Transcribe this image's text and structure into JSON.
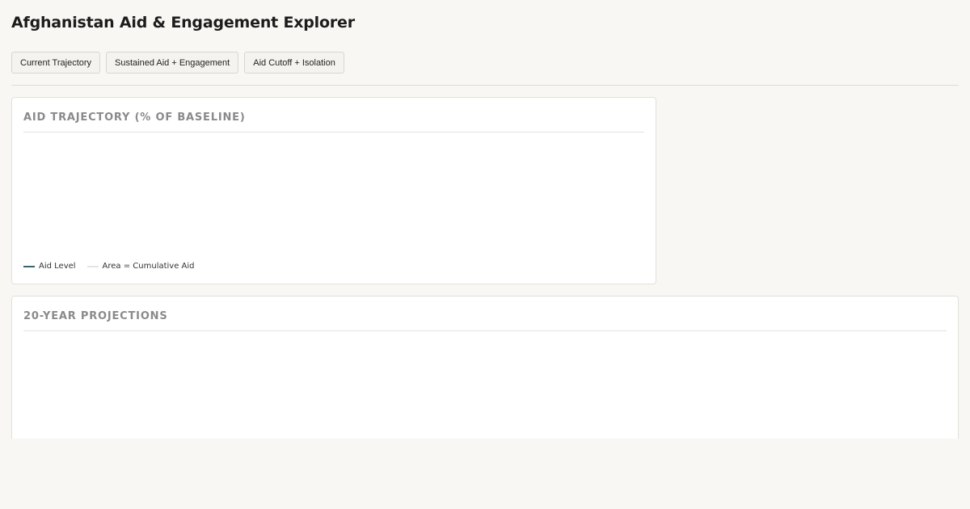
{
  "app": {
    "title": "Afghanistan Aid & Engagement Explorer"
  },
  "scenarios": [
    {
      "label": "Current Trajectory"
    },
    {
      "label": "Sustained Aid + Engagement"
    },
    {
      "label": "Aid Cutoff + Isolation"
    }
  ],
  "aid_panel": {
    "title": "AID TRAJECTORY (% OF BASELINE)",
    "legend": [
      {
        "label": "Aid Level",
        "color": "#2f6674"
      },
      {
        "label": "Area = Cumulative Aid",
        "color": "#e4e4e4"
      }
    ]
  },
  "projections_panel": {
    "title": "20-YEAR PROJECTIONS"
  },
  "colors": {
    "background": "#f8f7f3",
    "card": "#ffffff",
    "accent": "#2f6674",
    "muted_heading": "#8a8a8a"
  }
}
